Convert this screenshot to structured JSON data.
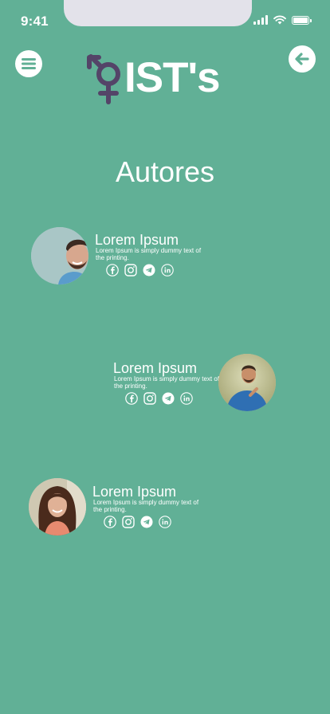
{
  "status_bar": {
    "time": "9:41"
  },
  "header": {
    "logo_text": "IST's",
    "menu_icon": "hamburger-menu-icon",
    "back_icon": "arrow-left-icon"
  },
  "page": {
    "title": "Autores"
  },
  "authors": [
    {
      "name": "Lorem Ipsum",
      "description": "Lorem Ipsum is simply dummy text of the printing."
    },
    {
      "name": "Lorem Ipsum",
      "description": "Lorem Ipsum is simply dummy text of the printing."
    },
    {
      "name": "Lorem Ipsum",
      "description": "Lorem Ipsum is simply dummy text of the printing."
    }
  ],
  "social_icons": [
    "facebook-icon",
    "instagram-icon",
    "telegram-icon",
    "linkedin-icon"
  ],
  "colors": {
    "background": "#61b096",
    "logo_symbol": "#544468",
    "foreground": "#ffffff"
  }
}
